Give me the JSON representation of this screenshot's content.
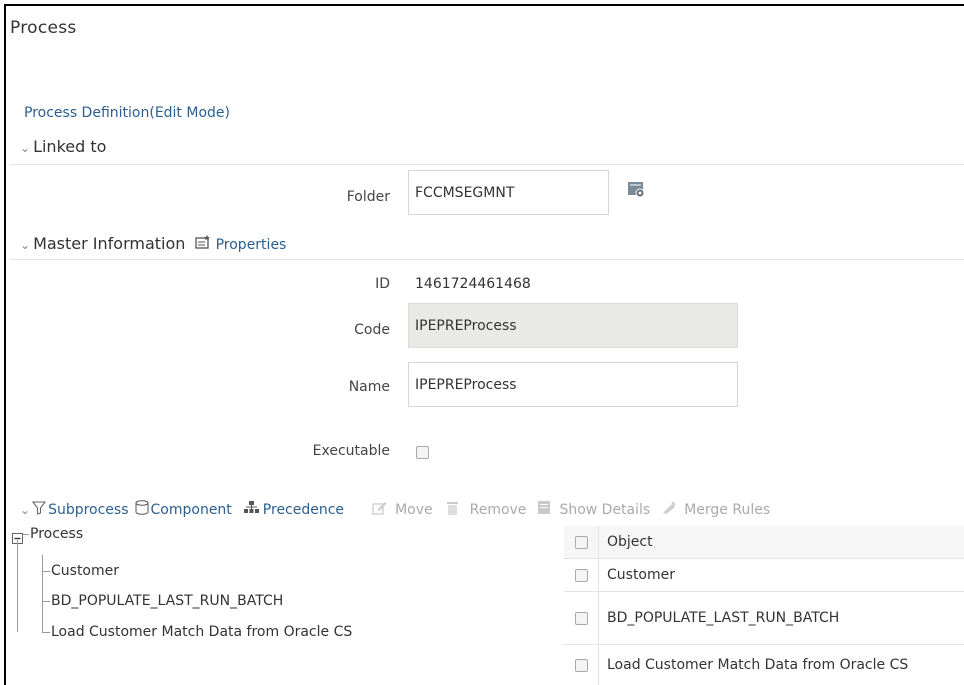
{
  "page": {
    "title": "Process",
    "mode_title": "Process Definition(Edit Mode)"
  },
  "linked_to": {
    "header": "Linked to",
    "folder_label": "Folder",
    "folder_value": "FCCMSEGMNT"
  },
  "master": {
    "header": "Master Information",
    "properties_label": "Properties",
    "id_label": "ID",
    "id_value": "1461724461468",
    "code_label": "Code",
    "code_value": "IPEPREProcess",
    "name_label": "Name",
    "name_value": "IPEPREProcess",
    "executable_label": "Executable"
  },
  "toolbar": {
    "subprocess": "Subprocess",
    "component": "Component",
    "precedence": "Precedence",
    "move": "Move",
    "remove": "Remove",
    "show_details": "Show Details",
    "merge_rules": "Merge Rules"
  },
  "tree": {
    "root": "Process",
    "children": [
      "Customer",
      "BD_POPULATE_LAST_RUN_BATCH",
      "Load Customer Match Data from Oracle CS"
    ]
  },
  "grid": {
    "header": "Object",
    "rows": [
      "Customer",
      "BD_POPULATE_LAST_RUN_BATCH",
      "Load Customer Match Data from Oracle CS"
    ]
  },
  "colors": {
    "link": "#2b5f8f",
    "readonly_bg": "#e9e9e5"
  }
}
